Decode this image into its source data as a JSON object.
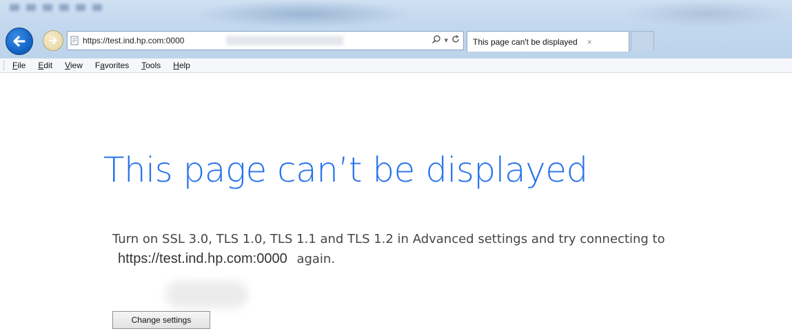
{
  "browser": {
    "address": {
      "url": "https://test.ind.hp.com:0000"
    },
    "tab": {
      "title": "This page can't be displayed",
      "close_glyph": "×"
    },
    "toolbar": {
      "search_glyph": "⚲",
      "dropdown_glyph": "▾",
      "refresh_glyph": "↻"
    }
  },
  "menu": {
    "items": [
      {
        "label_u": "F",
        "label_rest": "ile"
      },
      {
        "label_u": "E",
        "label_rest": "dit"
      },
      {
        "label_u": "V",
        "label_rest": "iew"
      },
      {
        "label_pre": "F",
        "label_u": "a",
        "label_rest": "vorites"
      },
      {
        "label_u": "T",
        "label_rest": "ools"
      },
      {
        "label_u": "H",
        "label_rest": "elp"
      }
    ]
  },
  "error": {
    "title": "This page can’t be displayed",
    "message_before": "Turn on SSL 3.0, TLS 1.0, TLS 1.1 and TLS 1.2 in Advanced settings and try connecting to",
    "url": "https://test.ind.hp.com:0000",
    "message_after": "again.",
    "button_label": "Change settings"
  },
  "colors": {
    "title_blue": "#2672ec",
    "back_button": "#1565c8",
    "body_text": "#444444"
  },
  "icons": {
    "back": "back-arrow-icon",
    "forward": "forward-arrow-icon",
    "address": "page-icon",
    "search": "search-icon",
    "refresh": "refresh-icon"
  }
}
